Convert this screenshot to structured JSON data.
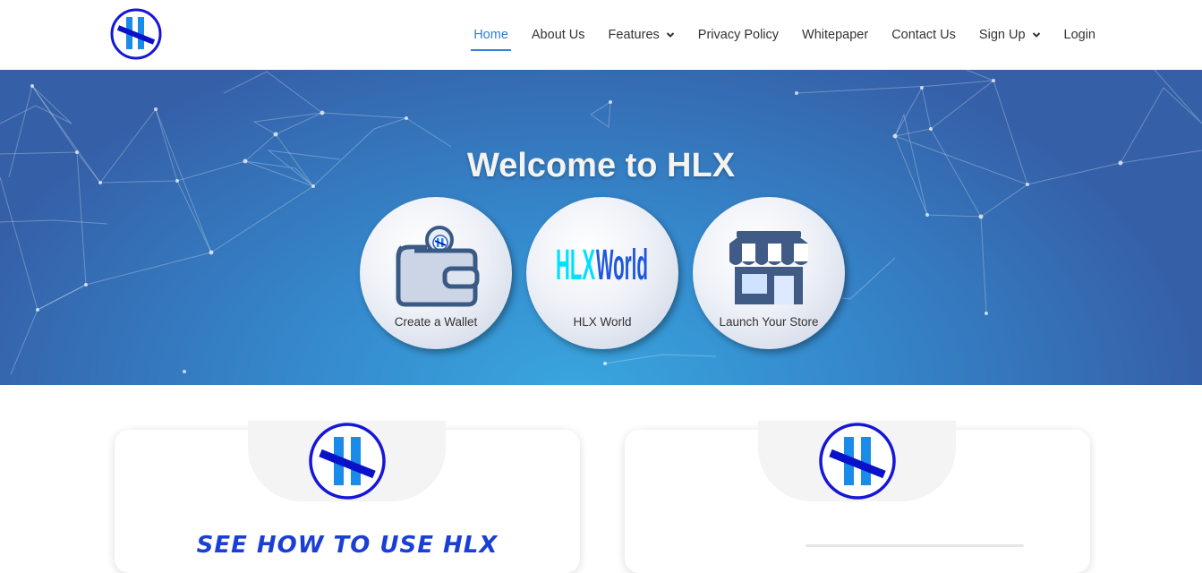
{
  "header": {
    "logo_alt": "HLX logo",
    "nav": [
      {
        "label": "Home",
        "active": true,
        "dropdown": false
      },
      {
        "label": "About Us",
        "active": false,
        "dropdown": false
      },
      {
        "label": "Features",
        "active": false,
        "dropdown": true
      },
      {
        "label": "Privacy Policy",
        "active": false,
        "dropdown": false
      },
      {
        "label": "Whitepaper",
        "active": false,
        "dropdown": false
      },
      {
        "label": "Contact Us",
        "active": false,
        "dropdown": false
      },
      {
        "label": "Sign Up",
        "active": false,
        "dropdown": true
      },
      {
        "label": "Login",
        "active": false,
        "dropdown": false
      }
    ]
  },
  "hero": {
    "title": "Welcome to HLX",
    "buttons": [
      {
        "label": "Create a Wallet",
        "icon": "wallet-icon"
      },
      {
        "label": "HLX World",
        "icon": "hlx-world-logo",
        "logo_text_a": "HLX",
        "logo_text_b": "World"
      },
      {
        "label": "Launch Your Store",
        "icon": "store-icon"
      }
    ]
  },
  "cards": {
    "left_heading": "SEE HOW TO USE HLX"
  },
  "colors": {
    "accent": "#2f7ed8",
    "brand_blue": "#1a3fd6",
    "hero_dark": "#3560a8",
    "hero_light": "#39a6df"
  }
}
